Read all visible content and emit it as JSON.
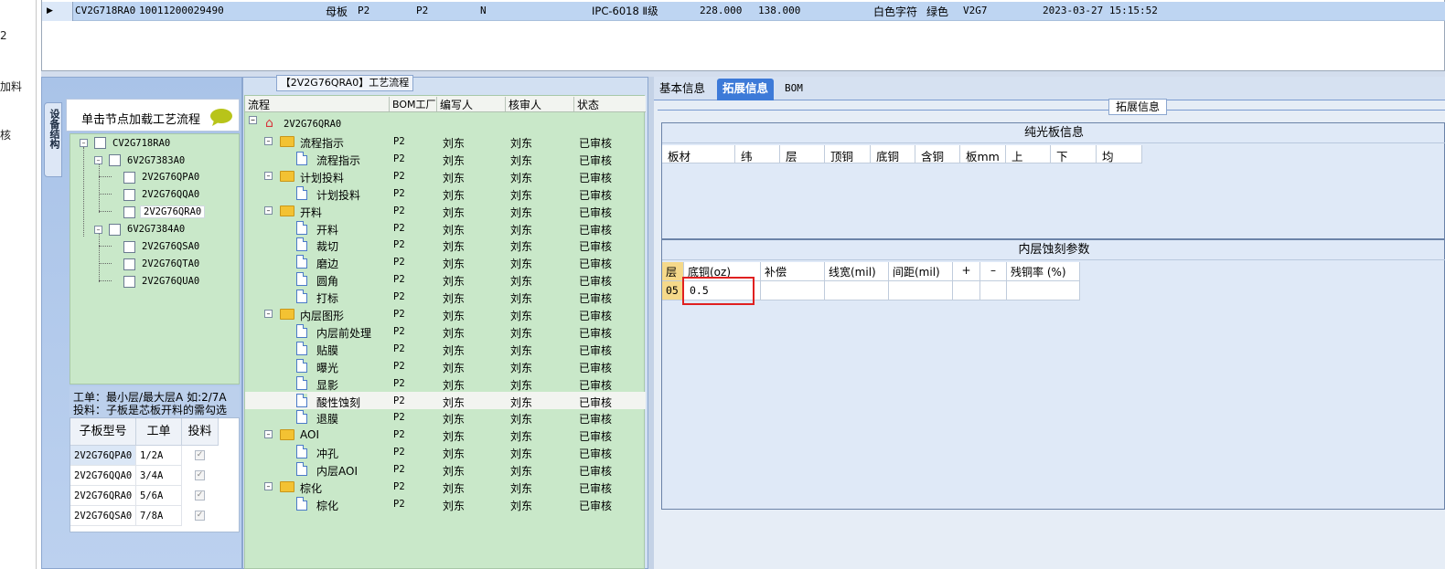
{
  "left_strip": {
    "labels": [
      "2",
      "加料",
      "核"
    ]
  },
  "top_grid": {
    "row": {
      "c1": "CV2G718RA0",
      "c2": "10011200029490",
      "c3": "母板",
      "c4": "P2",
      "c5": "P2",
      "c6": "N",
      "c7": "IPC-6018 Ⅱ级",
      "c8": "228.000",
      "c9": "138.000",
      "c10": "白色字符",
      "c11": "绿色",
      "c12": "V2G7",
      "c13": "2023-03-27 15:15:52"
    }
  },
  "left_panel": {
    "vtab": "设备结构",
    "load_hint": "单击节点加载工艺流程",
    "tree": {
      "root": "CV2G718RA0",
      "g1": "6V2G7383A0",
      "g1c": [
        "2V2G76QPA0",
        "2V2G76QQA0",
        "2V2G76QRA0"
      ],
      "g2": "6V2G7384A0",
      "g2c": [
        "2V2G76QSA0",
        "2V2G76QTA0",
        "2V2G76QUA0"
      ]
    },
    "info_line1": "工单：最小层/最大层A 如:2/7A",
    "info_line2": "投料：子板是芯板开料的需勾选",
    "sub_headers": [
      "子板型号",
      "工单",
      "投料"
    ],
    "sub_rows": [
      [
        "2V2G76QPA0",
        "1/2A"
      ],
      [
        "2V2G76QQA0",
        "3/4A"
      ],
      [
        "2V2G76QRA0",
        "5/6A"
      ],
      [
        "2V2G76QSA0",
        "7/8A"
      ]
    ]
  },
  "process": {
    "title": "【2V2G76QRA0】工艺流程",
    "headers": [
      "流程",
      "BOM工厂",
      "编写人",
      "核审人",
      "状态"
    ],
    "root": "2V2G76QRA0",
    "rows": [
      {
        "name": "流程指示",
        "bom": "P2",
        "writer": "刘东",
        "reviewer": "刘东",
        "status": "已审核"
      },
      {
        "name": "流程指示",
        "bom": "P2",
        "writer": "刘东",
        "reviewer": "刘东",
        "status": "已审核"
      },
      {
        "name": "计划投料",
        "bom": "P2",
        "writer": "刘东",
        "reviewer": "刘东",
        "status": "已审核"
      },
      {
        "name": "计划投料",
        "bom": "P2",
        "writer": "刘东",
        "reviewer": "刘东",
        "status": "已审核"
      },
      {
        "name": "开料",
        "bom": "P2",
        "writer": "刘东",
        "reviewer": "刘东",
        "status": "已审核"
      },
      {
        "name": "开料",
        "bom": "P2",
        "writer": "刘东",
        "reviewer": "刘东",
        "status": "已审核"
      },
      {
        "name": "裁切",
        "bom": "P2",
        "writer": "刘东",
        "reviewer": "刘东",
        "status": "已审核"
      },
      {
        "name": "磨边",
        "bom": "P2",
        "writer": "刘东",
        "reviewer": "刘东",
        "status": "已审核"
      },
      {
        "name": "圆角",
        "bom": "P2",
        "writer": "刘东",
        "reviewer": "刘东",
        "status": "已审核"
      },
      {
        "name": "打标",
        "bom": "P2",
        "writer": "刘东",
        "reviewer": "刘东",
        "status": "已审核"
      },
      {
        "name": "内层图形",
        "bom": "P2",
        "writer": "刘东",
        "reviewer": "刘东",
        "status": "已审核"
      },
      {
        "name": "内层前处理",
        "bom": "P2",
        "writer": "刘东",
        "reviewer": "刘东",
        "status": "已审核"
      },
      {
        "name": "贴膜",
        "bom": "P2",
        "writer": "刘东",
        "reviewer": "刘东",
        "status": "已审核"
      },
      {
        "name": "曝光",
        "bom": "P2",
        "writer": "刘东",
        "reviewer": "刘东",
        "status": "已审核"
      },
      {
        "name": "显影",
        "bom": "P2",
        "writer": "刘东",
        "reviewer": "刘东",
        "status": "已审核"
      },
      {
        "name": "酸性蚀刻",
        "bom": "P2",
        "writer": "刘东",
        "reviewer": "刘东",
        "status": "已审核"
      },
      {
        "name": "退膜",
        "bom": "P2",
        "writer": "刘东",
        "reviewer": "刘东",
        "status": "已审核"
      },
      {
        "name": "AOI",
        "bom": "P2",
        "writer": "刘东",
        "reviewer": "刘东",
        "status": "已审核"
      },
      {
        "name": "冲孔",
        "bom": "P2",
        "writer": "刘东",
        "reviewer": "刘东",
        "status": "已审核"
      },
      {
        "name": "内层AOI",
        "bom": "P2",
        "writer": "刘东",
        "reviewer": "刘东",
        "status": "已审核"
      },
      {
        "name": "棕化",
        "bom": "P2",
        "writer": "刘东",
        "reviewer": "刘东",
        "status": "已审核"
      },
      {
        "name": "棕化",
        "bom": "P2",
        "writer": "刘东",
        "reviewer": "刘东",
        "status": "已审核"
      }
    ]
  },
  "right": {
    "tabs": [
      "基本信息",
      "拓展信息",
      "BOM"
    ],
    "ext_header": "拓展信息",
    "sec1_title": "纯光板信息",
    "sec1_headers": [
      "板材",
      "纬",
      "层",
      "顶铜",
      "底铜",
      "含铜",
      "板mm",
      "上",
      "下",
      "均"
    ],
    "sec2_title": "内层蚀刻参数",
    "sec2_headers": [
      "层",
      "底铜(oz)",
      "补偿",
      "线宽(mil)",
      "间距(mil)",
      "+",
      "–",
      "残铜率 (%)"
    ],
    "sec2_row": {
      "layer": "05",
      "base_cu": "0.5"
    }
  }
}
